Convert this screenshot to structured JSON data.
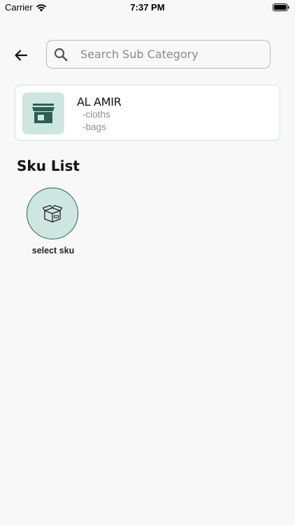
{
  "status_bar": {
    "carrier": "Carrier",
    "time": "7:37 PM"
  },
  "header": {
    "back_icon": "arrow-left-icon",
    "search": {
      "placeholder": "Search Sub Category",
      "value": "",
      "icon": "search-icon"
    }
  },
  "store": {
    "name": "AL AMIR",
    "categories": [
      "-cloths",
      "-bags"
    ],
    "icon": "storefront-icon"
  },
  "sku_section": {
    "title": "Sku List",
    "items": [
      {
        "label": "select sku",
        "icon": "box-icon"
      }
    ]
  },
  "colors": {
    "accent": "#2f5e55",
    "accent_light": "#cde6e0",
    "background": "#f8f8f8"
  }
}
